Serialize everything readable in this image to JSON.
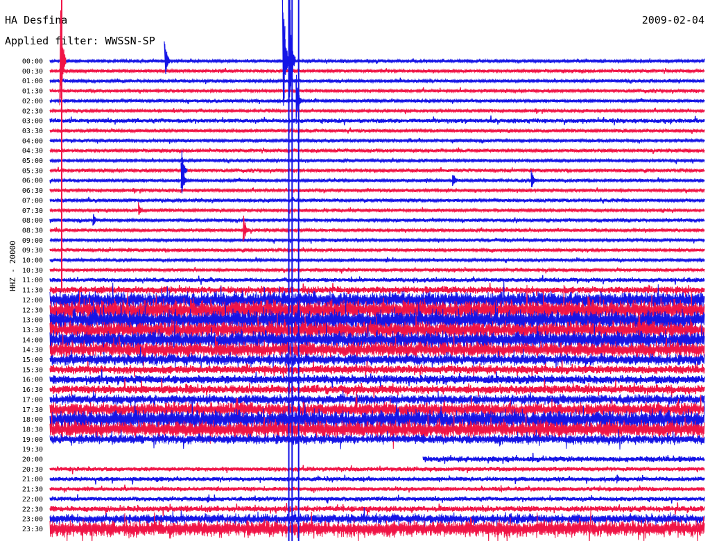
{
  "header": {
    "station": "HA Desfina",
    "filter_text": "Applied filter: WWSSN-SP",
    "date": "2009-02-04",
    "channel": "HHZ - 20000"
  },
  "colors": {
    "trace_a": "#1414e6",
    "trace_b": "#f01446"
  },
  "chart_data": {
    "type": "line",
    "title": "HA Desfina",
    "subtitle": "Applied filter: WWSSN-SP",
    "date": "2009-02-04",
    "ylabel": "HHZ - 20000",
    "xlabel": "",
    "grid": false,
    "legend": "none",
    "rows": [
      {
        "label": "00:00",
        "amp": 2
      },
      {
        "label": "00:30",
        "amp": 2
      },
      {
        "label": "01:00",
        "amp": 2
      },
      {
        "label": "01:30",
        "amp": 2
      },
      {
        "label": "02:00",
        "amp": 2
      },
      {
        "label": "02:30",
        "amp": 2
      },
      {
        "label": "03:00",
        "amp": 3
      },
      {
        "label": "03:30",
        "amp": 2
      },
      {
        "label": "04:00",
        "amp": 2
      },
      {
        "label": "04:30",
        "amp": 2
      },
      {
        "label": "05:00",
        "amp": 2
      },
      {
        "label": "05:30",
        "amp": 2
      },
      {
        "label": "06:00",
        "amp": 2
      },
      {
        "label": "06:30",
        "amp": 2
      },
      {
        "label": "07:00",
        "amp": 2
      },
      {
        "label": "07:30",
        "amp": 2
      },
      {
        "label": "08:00",
        "amp": 2
      },
      {
        "label": "08:30",
        "amp": 2
      },
      {
        "label": "09:00",
        "amp": 2
      },
      {
        "label": "09:30",
        "amp": 2
      },
      {
        "label": "10:00",
        "amp": 2
      },
      {
        "label": "10:30",
        "amp": 2
      },
      {
        "label": "11:00",
        "amp": 3
      },
      {
        "label": "11:30",
        "amp": 5
      },
      {
        "label": "12:00",
        "amp": 12
      },
      {
        "label": "12:30",
        "amp": 14
      },
      {
        "label": "13:00",
        "amp": 14
      },
      {
        "label": "13:30",
        "amp": 12
      },
      {
        "label": "14:00",
        "amp": 12
      },
      {
        "label": "14:30",
        "amp": 11
      },
      {
        "label": "15:00",
        "amp": 8
      },
      {
        "label": "15:30",
        "amp": 6
      },
      {
        "label": "16:00",
        "amp": 6
      },
      {
        "label": "16:30",
        "amp": 6
      },
      {
        "label": "17:00",
        "amp": 7
      },
      {
        "label": "17:30",
        "amp": 10
      },
      {
        "label": "18:00",
        "amp": 13
      },
      {
        "label": "18:30",
        "amp": 12
      },
      {
        "label": "19:00",
        "amp": 7
      },
      {
        "label": "19:30",
        "amp": 0,
        "end_fraction": 0.0
      },
      {
        "label": "20:00",
        "amp": 4,
        "start_fraction": 0.57
      },
      {
        "label": "20:30",
        "amp": 3
      },
      {
        "label": "21:00",
        "amp": 3
      },
      {
        "label": "21:30",
        "amp": 3
      },
      {
        "label": "22:00",
        "amp": 3
      },
      {
        "label": "22:30",
        "amp": 4
      },
      {
        "label": "23:00",
        "amp": 7
      },
      {
        "label": "23:30",
        "amp": 12
      }
    ],
    "events": [
      {
        "row": 0,
        "x_fraction": 0.02,
        "amp": 90,
        "color_index": 1
      },
      {
        "row": 0,
        "x_fraction": 0.36,
        "amp": 120,
        "color_index": 0
      },
      {
        "row": 0,
        "x_fraction": 0.37,
        "amp": 110,
        "color_index": 0
      },
      {
        "row": 0,
        "x_fraction": 0.18,
        "amp": 30,
        "color_index": 0
      },
      {
        "row": 4,
        "x_fraction": 0.38,
        "amp": 45,
        "color_index": 0
      },
      {
        "row": 11,
        "x_fraction": 0.205,
        "amp": 35,
        "color_index": 0
      },
      {
        "row": 12,
        "x_fraction": 0.205,
        "amp": 30,
        "color_index": 0
      },
      {
        "row": 17,
        "x_fraction": 0.3,
        "amp": 25,
        "color_index": 1
      },
      {
        "row": 16,
        "x_fraction": 0.07,
        "amp": 12,
        "color_index": 0
      },
      {
        "row": 12,
        "x_fraction": 0.62,
        "amp": 12,
        "color_index": 0
      },
      {
        "row": 12,
        "x_fraction": 0.74,
        "amp": 15,
        "color_index": 0
      },
      {
        "row": 15,
        "x_fraction": 0.14,
        "amp": 12,
        "color_index": 1
      },
      {
        "row": 30,
        "x_fraction": 0.83,
        "amp": 10,
        "color_index": 0
      },
      {
        "row": 42,
        "x_fraction": 0.87,
        "amp": 10,
        "color_index": 0
      }
    ]
  }
}
